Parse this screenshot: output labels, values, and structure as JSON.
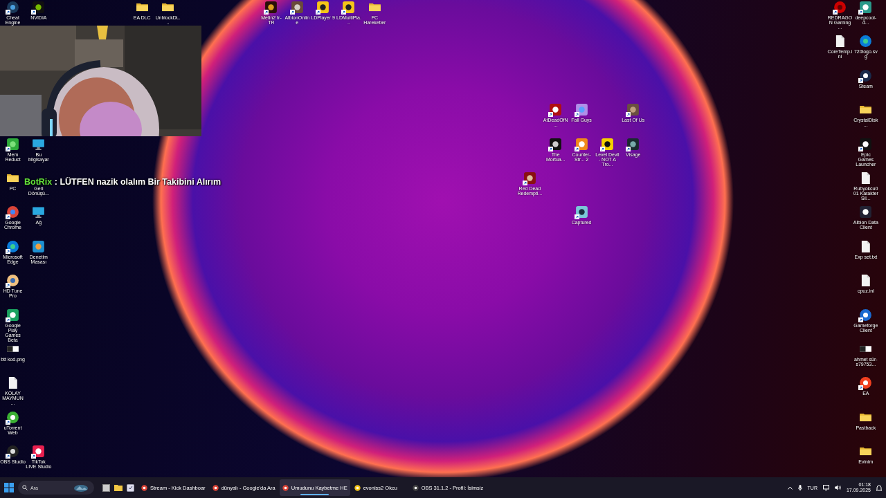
{
  "desktop_icons": [
    {
      "label": "Cheat Engine",
      "shortcut": true
    },
    {
      "label": "NVIDIA",
      "shortcut": true
    },
    {
      "label": "EA DLC",
      "shortcut": false
    },
    {
      "label": "UnblockDL...",
      "shortcut": false
    },
    {
      "label": "Metin2 tr-TR",
      "shortcut": true
    },
    {
      "label": "AlbionOnline",
      "shortcut": true
    },
    {
      "label": "LDPlayer 9",
      "shortcut": true
    },
    {
      "label": "LDMultiPla...",
      "shortcut": true
    },
    {
      "label": "PC Hareketler",
      "shortcut": false
    },
    {
      "label": "Mem Reduct",
      "shortcut": true
    },
    {
      "label": "Bu bilgisayar",
      "shortcut": false
    },
    {
      "label": "PC",
      "shortcut": false
    },
    {
      "label": "Geri Dönüşü...",
      "shortcut": false
    },
    {
      "label": "Google Chrome",
      "shortcut": true
    },
    {
      "label": "Ağ",
      "shortcut": false
    },
    {
      "label": "Microsoft Edge",
      "shortcut": true
    },
    {
      "label": "Denetim Masası",
      "shortcut": false
    },
    {
      "label": "HD Tune Pro",
      "shortcut": true
    },
    {
      "label": "Google Play Games Beta",
      "shortcut": true
    },
    {
      "label": "btt kod.png",
      "shortcut": false
    },
    {
      "label": "KOLAY MAYMUN ...",
      "shortcut": false
    },
    {
      "label": "uTorrent Web",
      "shortcut": true
    },
    {
      "label": "OBS Studio",
      "shortcut": true
    },
    {
      "label": "TikTok LIVE Studio",
      "shortcut": true
    },
    {
      "label": "AtDeadOfN...",
      "shortcut": true
    },
    {
      "label": "Fall Guys",
      "shortcut": true
    },
    {
      "label": "Last Of Us",
      "shortcut": true
    },
    {
      "label": "The Mortua...",
      "shortcut": true
    },
    {
      "label": "Counter-Str... 2",
      "shortcut": true
    },
    {
      "label": "Level Devil - NOT A Tro...",
      "shortcut": true
    },
    {
      "label": "Visage",
      "shortcut": true
    },
    {
      "label": "Red Dead Redempti...",
      "shortcut": true
    },
    {
      "label": "Captured",
      "shortcut": true
    },
    {
      "label": "REDRAGON Gaming ...",
      "shortcut": true
    },
    {
      "label": "deepcool-d...",
      "shortcut": true
    },
    {
      "label": "CoreTemp.ini",
      "shortcut": false
    },
    {
      "label": "720logo.svg",
      "shortcut": false
    },
    {
      "label": "Steam",
      "shortcut": true
    },
    {
      "label": "CrystalDisk...",
      "shortcut": false
    },
    {
      "label": "Epic Games Launcher",
      "shortcut": true
    },
    {
      "label": "Rubyokcu001 Karakter Sil...",
      "shortcut": false
    },
    {
      "label": "Albion Data Client",
      "shortcut": false
    },
    {
      "label": "Exp set.txt",
      "shortcut": false
    },
    {
      "label": "cpuz.ini",
      "shortcut": false
    },
    {
      "label": "Gameforge Client",
      "shortcut": true
    },
    {
      "label": "ahmet sür-s79753...",
      "shortcut": false
    },
    {
      "label": "EA",
      "shortcut": true
    },
    {
      "label": "Pastback",
      "shortcut": false
    },
    {
      "label": "Evinim",
      "shortcut": false
    }
  ],
  "chat_overlay": {
    "user": "BotRix",
    "message": ": LÜTFEN nazik olalım Bir Takibini Alırım"
  },
  "taskbar": {
    "search": {
      "placeholder": "Ara"
    },
    "windows": [
      {
        "label": "Stream - Kick Dashboar",
        "selected": false
      },
      {
        "label": "dünyalı - Google'da Ara",
        "selected": false
      },
      {
        "label": "Umudunu Kaybetme HE",
        "selected": true
      },
      {
        "label": "evoniss2 Okcu",
        "selected": false
      },
      {
        "label": "OBS 31.1.2 - Profil: İsimsiz",
        "selected": false
      }
    ],
    "language": "TUR",
    "time": "01:18",
    "date": "17.09.2025"
  }
}
